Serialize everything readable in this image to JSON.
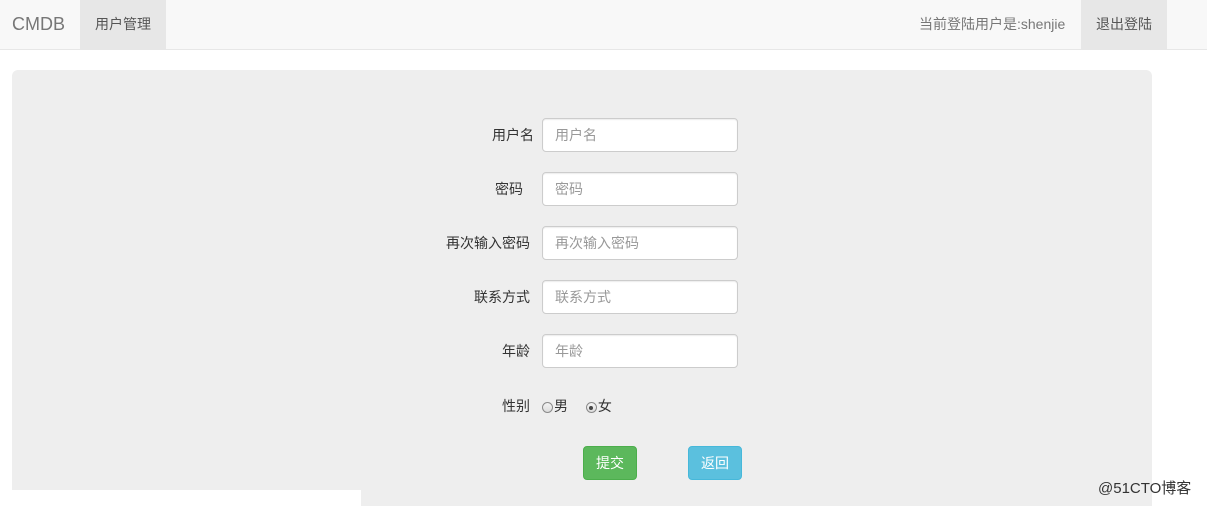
{
  "navbar": {
    "brand": "CMDB",
    "active_item": "用户管理",
    "user_text": "当前登陆用户是:shenjie",
    "logout": "退出登陆"
  },
  "form": {
    "fields": [
      {
        "label": "用户名",
        "placeholder": "用户名"
      },
      {
        "label": "密码",
        "placeholder": "密码"
      },
      {
        "label": "再次输入密码",
        "placeholder": "再次输入密码"
      },
      {
        "label": "联系方式",
        "placeholder": "联系方式"
      },
      {
        "label": "年龄",
        "placeholder": "年龄"
      }
    ],
    "gender": {
      "label": "性别",
      "options": [
        "男",
        "女"
      ],
      "selected": "女"
    },
    "submit": "提交",
    "back": "返回"
  },
  "watermark": "@51CTO博客"
}
